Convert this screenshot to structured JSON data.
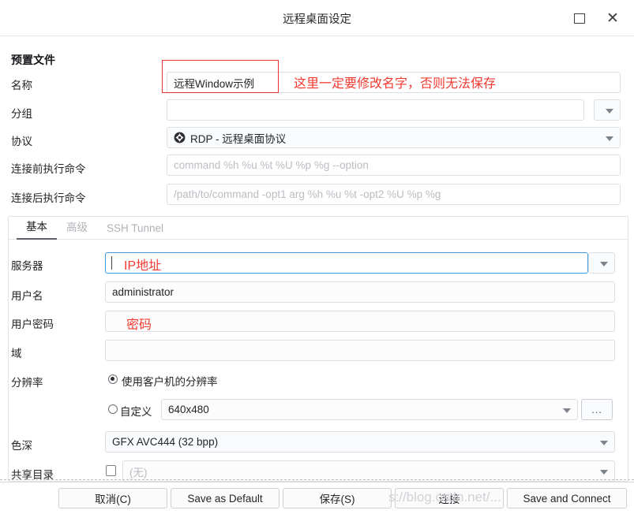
{
  "window": {
    "title": "远程桌面设定",
    "maximize_icon": "maximize-square-icon",
    "close_icon": "close-x-icon",
    "close_glyph": "✕"
  },
  "profile": {
    "section_title": "预置文件",
    "rows": {
      "name": {
        "label": "名称",
        "value": "远程Window示例"
      },
      "group": {
        "label": "分组",
        "value": ""
      },
      "protocol": {
        "label": "协议",
        "value": "RDP - 远程桌面协议",
        "icon": "rdp-protocol-icon"
      },
      "pre_command": {
        "label": "连接前执行命令",
        "placeholder": "command %h %u %t %U %p %g --option"
      },
      "post_command": {
        "label": "连接后执行命令",
        "placeholder": "/path/to/command -opt1 arg %h %u %t -opt2 %U %p %g"
      }
    }
  },
  "tabs": [
    {
      "label": "基本",
      "active": true
    },
    {
      "label": "高级",
      "active": false
    },
    {
      "label": "SSH Tunnel",
      "active": false
    }
  ],
  "basic": {
    "server": {
      "label": "服务器",
      "value": ""
    },
    "username": {
      "label": "用户名",
      "value": "administrator"
    },
    "password": {
      "label": "用户密码",
      "value": ""
    },
    "domain": {
      "label": "域",
      "value": ""
    },
    "resolution": {
      "label": "分辨率",
      "option_client": "使用客户机的分辨率",
      "option_custom": "自定义",
      "custom_placeholder": "640x480",
      "selected": "client",
      "browse_label": "..."
    },
    "color_depth": {
      "label": "色深",
      "value": "GFX AVC444 (32 bpp)"
    },
    "share_folder": {
      "label": "共享目录",
      "value": "(无)",
      "checked": false
    }
  },
  "annotations": [
    {
      "text": "这里一定要修改名字，否则无法保存",
      "color": "#f0392f"
    },
    {
      "text": "IP地址",
      "color": "#f0392f"
    },
    {
      "text": "密码",
      "color": "#f0392f"
    }
  ],
  "buttons": [
    {
      "label": "取消(C)"
    },
    {
      "label": "Save as Default"
    },
    {
      "label": "保存(S)"
    },
    {
      "label": "连接"
    },
    {
      "label": "Save and Connect"
    }
  ],
  "watermark": {
    "text": "s://blog.csdn.net/..."
  },
  "colors": {
    "accent_red": "#f0392f",
    "focus_blue": "#3f9ae0",
    "border": "#dcdfe3"
  }
}
